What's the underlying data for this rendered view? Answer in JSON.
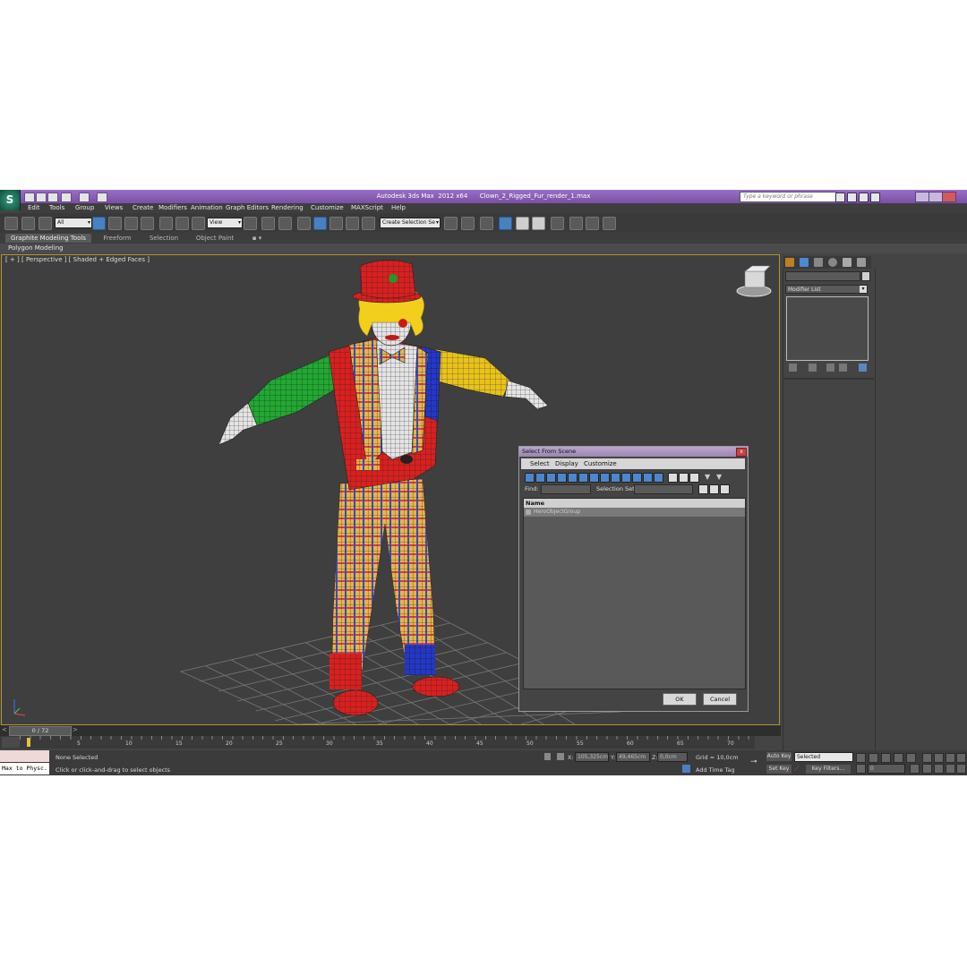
{
  "title_bar": {
    "app_title": "Autodesk 3ds Max  2012 x64",
    "file_name": "Clown_2_Rigged_Fur_render_1.max",
    "search_placeholder": "Type a keyword or phrase"
  },
  "menu": [
    "Edit",
    "Tools",
    "Group",
    "Views",
    "Create",
    "Modifiers",
    "Animation",
    "Graph Editors",
    "Rendering",
    "Customize",
    "MAXScript",
    "Help"
  ],
  "toolbar": {
    "selection_filter": "All",
    "reference_coord": "View",
    "named_selection_placeholder": "Create Selection Se"
  },
  "ribbon": {
    "tabs": [
      "Graphite Modeling Tools",
      "Freeform",
      "Selection",
      "Object Paint"
    ],
    "panel_label": "Polygon Modeling"
  },
  "viewport": {
    "label": "[ + ] [ Perspective ] [ Shaded + Edged Faces ]"
  },
  "command_panel": {
    "modifier_list": "Modifier List"
  },
  "dialog": {
    "title": "Select From Scene",
    "close": "x",
    "menu": [
      "Select",
      "Display",
      "Customize"
    ],
    "find_label": "Find:",
    "selection_set_label": "Selection Set:",
    "column_name": "Name",
    "rows": [
      "HeroObjectGroup"
    ],
    "ok": "OK",
    "cancel": "Cancel"
  },
  "timeline": {
    "frame_counter": "0 / 72",
    "ticks": [
      "5",
      "10",
      "15",
      "20",
      "25",
      "30",
      "35",
      "40",
      "45",
      "50",
      "55",
      "60",
      "65",
      "70"
    ]
  },
  "status": {
    "script_listener": "Max to Physc.",
    "selection": "None Selected",
    "prompt": "Click or click-and-drag to select objects",
    "x_label": "X:",
    "x_value": "105,325cm",
    "y_label": "Y:",
    "y_value": "49,465cm",
    "z_label": "Z:",
    "z_value": "0,0cm",
    "grid": "Grid = 10,0cm",
    "add_time_tag": "Add Time Tag",
    "auto_key": "Auto Key",
    "set_key": "Set Key",
    "key_mode": "Selected",
    "key_filters": "Key Filters...",
    "current_frame": "0"
  },
  "colors": {
    "title_purple": "#8a5fb8",
    "viewport_border": "#b49432",
    "active_tool_blue": "#4a7fc0"
  }
}
